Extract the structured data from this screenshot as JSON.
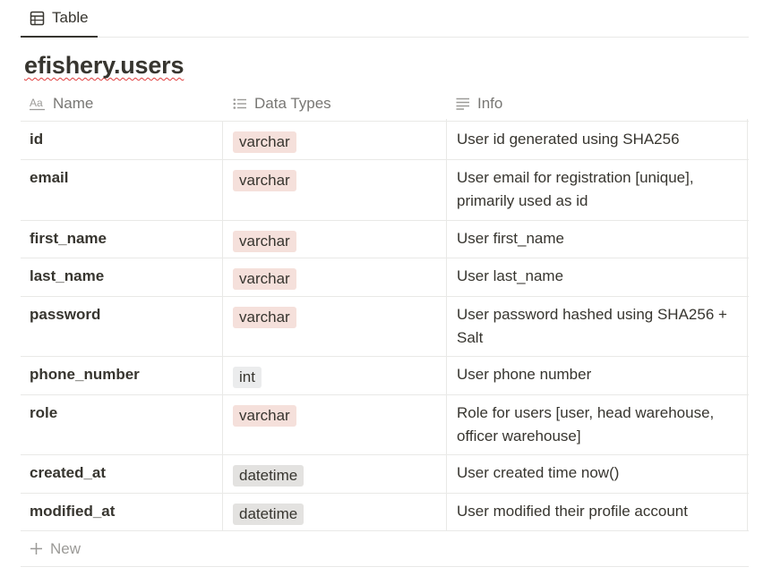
{
  "tabs": [
    {
      "label": "Table",
      "icon": "table-icon",
      "active": true
    }
  ],
  "title": "efishery.users",
  "columns": [
    {
      "label": "Name",
      "icon": "text-aa-icon"
    },
    {
      "label": "Data Types",
      "icon": "list-icon"
    },
    {
      "label": "Info",
      "icon": "lines-icon"
    }
  ],
  "rows": [
    {
      "name": "id",
      "type": "varchar",
      "info": "User id generated using SHA256"
    },
    {
      "name": "email",
      "type": "varchar",
      "info": "User email for registration [unique], primarily used as id"
    },
    {
      "name": "first_name",
      "type": "varchar",
      "info": "User first_name"
    },
    {
      "name": "last_name",
      "type": "varchar",
      "info": "User last_name"
    },
    {
      "name": "password",
      "type": "varchar",
      "info": "User password hashed using SHA256 + Salt"
    },
    {
      "name": "phone_number",
      "type": "int",
      "info": "User phone number"
    },
    {
      "name": "role",
      "type": "varchar",
      "info": "Role for users [user, head warehouse, officer warehouse]"
    },
    {
      "name": "created_at",
      "type": "datetime",
      "info": "User created time now()"
    },
    {
      "name": "modified_at",
      "type": "datetime",
      "info": "User modified their profile account"
    }
  ],
  "new_row_label": "New",
  "tag_colors": {
    "varchar": "#f5e0db",
    "int": "#ebeced",
    "datetime": "#e3e2e0"
  }
}
